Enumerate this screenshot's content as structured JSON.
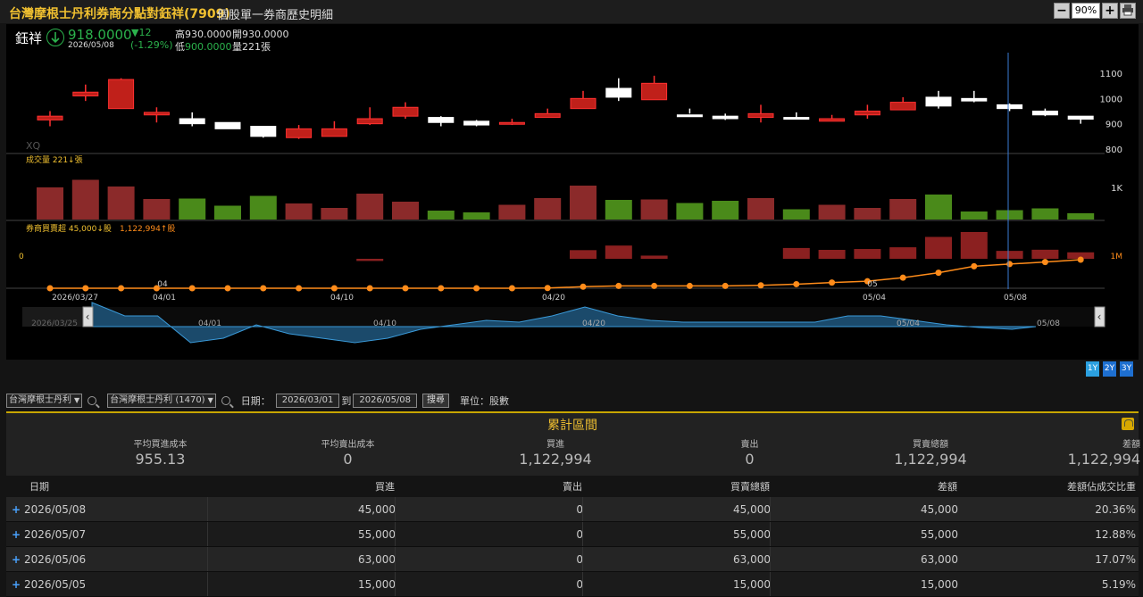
{
  "title": {
    "main": "台灣摩根士丹利券商分點對鈺祥(7909)",
    "sub": "個股單一券商歷史明細",
    "zoom": "90%",
    "zoom_minus": "−",
    "zoom_plus": "+"
  },
  "quote": {
    "name": "鈺祥",
    "price": "918.0000",
    "date": "2026/05/08",
    "change": "▼12",
    "pct": "(-1.29%)",
    "high_label": "高",
    "high": "930.0000",
    "open_label": "開",
    "open": "930.0000",
    "low_label": "低",
    "low": "900.0000",
    "vol_label": "量",
    "vol": "221張"
  },
  "chart_labels": {
    "watermark": "XQ",
    "volume_legend": "成交量 221↓張",
    "broker_legend_a": "券商買賣超 45,000↓股",
    "broker_legend_b": "1,122,994↑股",
    "price_ticks": [
      "1100",
      "1000",
      "900",
      "800"
    ],
    "vol_tick": "1K",
    "broker_zero": "0",
    "broker_right": "1M",
    "x_dates": [
      "2026/03/27",
      "04/01",
      "04/10",
      "04/20",
      "05/04",
      "05/08"
    ],
    "x_months": [
      "04",
      "05"
    ],
    "nav_dates": [
      "2026/03/25",
      "04/01",
      "04/10",
      "04/20",
      "05/04",
      "05/08"
    ]
  },
  "chart_data": {
    "type": "candlestick",
    "dates": [
      "03/26",
      "03/27",
      "03/30",
      "03/31",
      "04/01",
      "04/02",
      "04/06",
      "04/07",
      "04/08",
      "04/09",
      "04/10",
      "04/13",
      "04/14",
      "04/15",
      "04/16",
      "04/17",
      "04/20",
      "04/21",
      "04/22",
      "04/23",
      "04/24",
      "04/27",
      "04/28",
      "04/29",
      "04/30",
      "05/04",
      "05/05",
      "05/06",
      "05/07",
      "05/08"
    ],
    "open": [
      915,
      1010,
      960,
      935,
      920,
      905,
      890,
      845,
      850,
      900,
      930,
      925,
      910,
      900,
      925,
      960,
      1040,
      995,
      935,
      930,
      925,
      925,
      910,
      935,
      955,
      1005,
      1000,
      975,
      950,
      930
    ],
    "close": [
      930,
      1025,
      1075,
      945,
      900,
      880,
      850,
      880,
      880,
      920,
      965,
      905,
      895,
      905,
      940,
      1000,
      1005,
      1060,
      930,
      920,
      940,
      920,
      920,
      950,
      985,
      970,
      990,
      960,
      935,
      918
    ],
    "high": [
      950,
      1055,
      1080,
      965,
      945,
      905,
      890,
      895,
      910,
      965,
      985,
      930,
      915,
      920,
      960,
      1030,
      1080,
      1090,
      960,
      940,
      975,
      945,
      935,
      975,
      1005,
      1030,
      1030,
      980,
      960,
      930
    ],
    "low": [
      890,
      990,
      960,
      905,
      890,
      880,
      845,
      840,
      850,
      895,
      920,
      890,
      890,
      895,
      925,
      960,
      990,
      1000,
      940,
      915,
      905,
      925,
      910,
      920,
      955,
      960,
      985,
      950,
      930,
      900
    ],
    "volume": [
      720,
      890,
      740,
      460,
      470,
      310,
      530,
      360,
      260,
      580,
      400,
      200,
      160,
      330,
      480,
      760,
      440,
      450,
      370,
      420,
      480,
      230,
      330,
      260,
      460,
      560,
      180,
      210,
      250,
      140
    ],
    "broker_net": [
      0,
      0,
      0,
      0,
      0,
      0,
      0,
      0,
      0,
      -15000,
      0,
      0,
      0,
      0,
      0,
      60000,
      92000,
      22000,
      0,
      0,
      0,
      75000,
      62000,
      68000,
      80000,
      152000,
      186000,
      55000,
      63000,
      45000
    ],
    "broker_cum": [
      0,
      0,
      0,
      0,
      0,
      0,
      0,
      0,
      0,
      0,
      0,
      0,
      0,
      0,
      8000,
      60000,
      90000,
      90000,
      90000,
      90000,
      115000,
      160000,
      225000,
      275000,
      415000,
      610000,
      865000,
      950000,
      1030000,
      1122994
    ],
    "ylim": [
      800,
      1100
    ]
  },
  "range_buttons": [
    "1Y",
    "2Y",
    "3Y"
  ],
  "filter": {
    "broker": "台灣摩根士丹利",
    "branch": "台灣摩根士丹利 (1470)",
    "date_label": "日期：",
    "start": "2026/03/01",
    "to": "到",
    "end": "2026/05/08",
    "search": "搜尋",
    "unit": "單位：股數"
  },
  "summary": {
    "title": "累計區間",
    "items": [
      {
        "label": "平均買進成本",
        "value": "955.13"
      },
      {
        "label": "平均賣出成本",
        "value": "0"
      },
      {
        "label": "買進",
        "value": "1,122,994"
      },
      {
        "label": "賣出",
        "value": "0"
      },
      {
        "label": "買賣總額",
        "value": "1,122,994"
      },
      {
        "label": "差額",
        "value": "1,122,994"
      }
    ]
  },
  "table": {
    "headers": [
      "日期",
      "買進",
      "賣出",
      "買賣總額",
      "差額",
      "差額佔成交比重"
    ],
    "rows": [
      [
        "2026/05/08",
        "45,000",
        "0",
        "45,000",
        "45,000",
        "20.36%"
      ],
      [
        "2026/05/07",
        "55,000",
        "0",
        "55,000",
        "55,000",
        "12.88%"
      ],
      [
        "2026/05/06",
        "63,000",
        "0",
        "63,000",
        "63,000",
        "17.07%"
      ],
      [
        "2026/05/05",
        "15,000",
        "0",
        "15,000",
        "15,000",
        "5.19%"
      ]
    ]
  }
}
